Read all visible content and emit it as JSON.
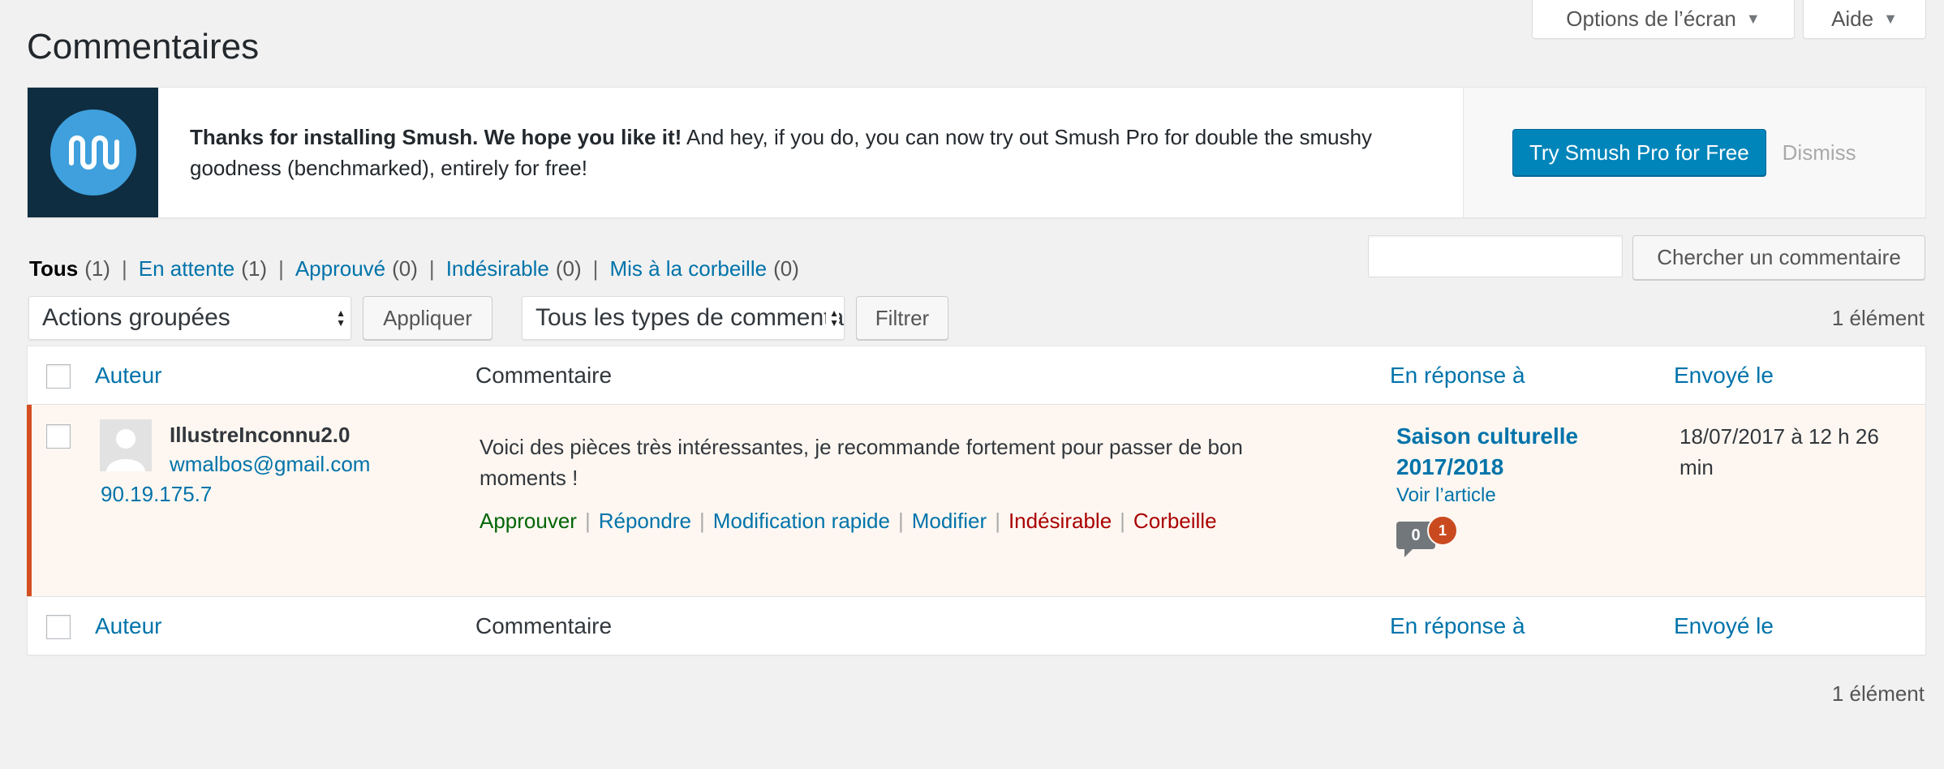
{
  "screen_meta": {
    "options_label": "Options de l’écran",
    "help_label": "Aide",
    "arrow": "▼"
  },
  "page_title": "Commentaires",
  "notice": {
    "bold_text": "Thanks for installing Smush. We hope you like it!",
    "text": " And hey, if you do, you can now try out Smush Pro for double the smushy goodness (benchmarked), entirely for free!",
    "cta_label": "Try Smush Pro for Free",
    "dismiss_label": "Dismiss",
    "logo_icon": "smush-logo-icon",
    "logo_bg": "#0f2d40",
    "logo_circle": "#3fa0dd"
  },
  "filters": {
    "all": {
      "label": "Tous",
      "count": "(1)"
    },
    "pending": {
      "label": "En attente",
      "count": "(1)"
    },
    "approved": {
      "label": "Approuvé",
      "count": "(0)"
    },
    "spam": {
      "label": "Indésirable",
      "count": "(0)"
    },
    "trash": {
      "label": "Mis à la corbeille",
      "count": "(0)"
    },
    "separator": "|"
  },
  "search": {
    "value": "",
    "button_label": "Chercher un commentaire"
  },
  "bulk": {
    "selected": "Actions groupées",
    "apply_label": "Appliquer"
  },
  "type_filter": {
    "selected": "Tous les types de commentaires",
    "button_label": "Filtrer"
  },
  "item_count": "1 élément",
  "columns": {
    "author": "Auteur",
    "comment": "Commentaire",
    "response": "En réponse à",
    "date": "Envoyé le"
  },
  "comment": {
    "author_name": "IllustreInconnu2.0",
    "author_email": "wmalbos@gmail.com",
    "author_ip": "90.19.175.7",
    "text": "Voici des pièces très intéressantes, je recommande fortement pour passer de bon moments !",
    "actions": {
      "approve": "Approuver",
      "reply": "Répondre",
      "quick_edit": "Modification rapide",
      "edit": "Modifier",
      "spam": "Indésirable",
      "trash": "Corbeille",
      "separator": "|"
    },
    "response_title": "Saison culturelle 2017/2018",
    "view_link": "Voir l’article",
    "approved_count": "0",
    "pending_count": "1",
    "date": "18/07/2017 à 12 h 26 min"
  },
  "colors": {
    "link": "#0073aa",
    "primary_button": "#0085ba",
    "pending_row_bg": "#fef7f1",
    "pending_border": "#d54e21",
    "approve": "#006505",
    "danger": "#aa0000"
  }
}
